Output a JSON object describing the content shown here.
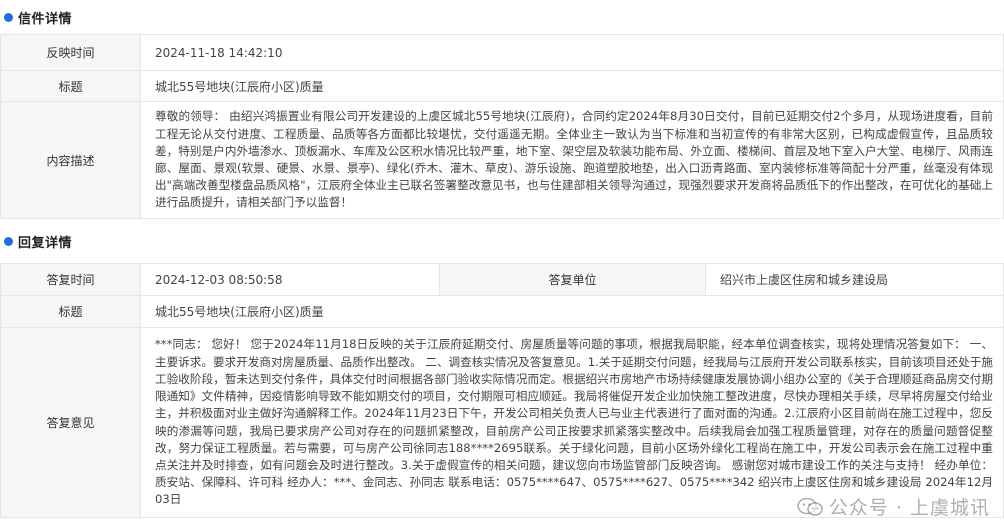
{
  "letter": {
    "section_title": "信件详情",
    "time_label": "反映时间",
    "time_value": "2024-11-18 14:42:10",
    "subject_label": "标题",
    "subject_value": "城北55号地块(江辰府小区)质量",
    "content_label": "内容描述",
    "content_value": "尊敬的领导：  由绍兴鸿振置业有限公司开发建设的上虞区城北55号地块(江辰府)，合同约定2024年8月30日交付，目前已延期交付2个多月，从现场进度看，目前工程无论从交付进度、工程质量、品质等各方面都比较堪忧，交付遥遥无期。全体业主一致认为当下标准和当初宣传的有非常大区别，已构成虚假宣传，且品质较差，特别是户内外墙渗水、顶板漏水、车库及公区积水情况比较严重，地下室、架空层及软装功能布局、外立面、楼梯间、首层及地下室入户大堂、电梯厅、风雨连廊、屋面、景观(软景、硬景、水景、景亭)、绿化(乔木、灌木、草皮)、游乐设施、跑道塑胶地垫，出入口沥青路面、室内装修标准等简配十分严重，丝毫没有体现出\"高端改善型楼盘品质风格\"，江辰府全体业主已联名签署整改意见书，也与住建部相关领导沟通过，现强烈要求开发商将品质低下的作出整改，在可优化的基础上进行品质提升，请相关部门予以监督！"
  },
  "reply": {
    "section_title": "回复详情",
    "time_label": "答复时间",
    "time_value": "2024-12-03 08:50:58",
    "unit_label": "答复单位",
    "unit_value": "绍兴市上虞区住房和城乡建设局",
    "subject_label": "标题",
    "subject_value": "城北55号地块(江辰府小区)质量",
    "opinion_label": "答复意见",
    "opinion_value": "***同志：  您好！  您于2024年11月18日反映的关于江辰府延期交付、房屋质量等问题的事项，根据我局职能，经本单位调查核实，现将处理情况答复如下：  一、主要诉求。要求开发商对房屋质量、品质作出整改。  二、调查核实情况及答复意见。1.关于延期交付问题，经我局与江辰府开发公司联系核实，目前该项目还处于施工验收阶段，暂未达到交付条件，具体交付时间根据各部门验收实际情况而定。根据绍兴市房地产市场持续健康发展协调小组办公室的《关于合理顺延商品房交付期限通知》文件精神，因疫情影响导致不能如期交付的项目，交付期限可相应顺延。我局将催促开发企业加快施工整改进度，尽快办理相关手续，尽早将房屋交付给业主，并积极面对业主做好沟通解释工作。2024年11月23日下午，开发公司相关负责人已与业主代表进行了面对面的沟通。2.江辰府小区目前尚在施工过程中，您反映的渗漏等问题，我局已要求房产公司对存在的问题抓紧整改，目前房产公司正按要求抓紧落实整改中。后续我局会加强工程质量管理，对存在的质量问题督促整改，努力保证工程质量。若与需要，可与房产公司徐同志188****2695联系。关于绿化问题，目前小区场外绿化工程尚在施工中，开发公司表示会在施工过程中重点关注并及时排查，如有问题会及时进行整改。3.关于虚假宣传的相关问题，建议您向市场监管部门反映咨询。  感谢您对城市建设工作的关注与支持！  经办单位：质安站、保障科、许可科  经办人：***、金同志、孙同志  联系电话：0575****647、0575****627、0575****342  绍兴市上虞区住房和城乡建设局  2024年12月03日"
  },
  "watermark": {
    "icon": "wechat-icon",
    "text": "公众号 · 上虞城讯"
  },
  "colors": {
    "accent": "#1e6fd9",
    "label_bg": "#f5f6f7",
    "border": "#e6e6e6"
  }
}
